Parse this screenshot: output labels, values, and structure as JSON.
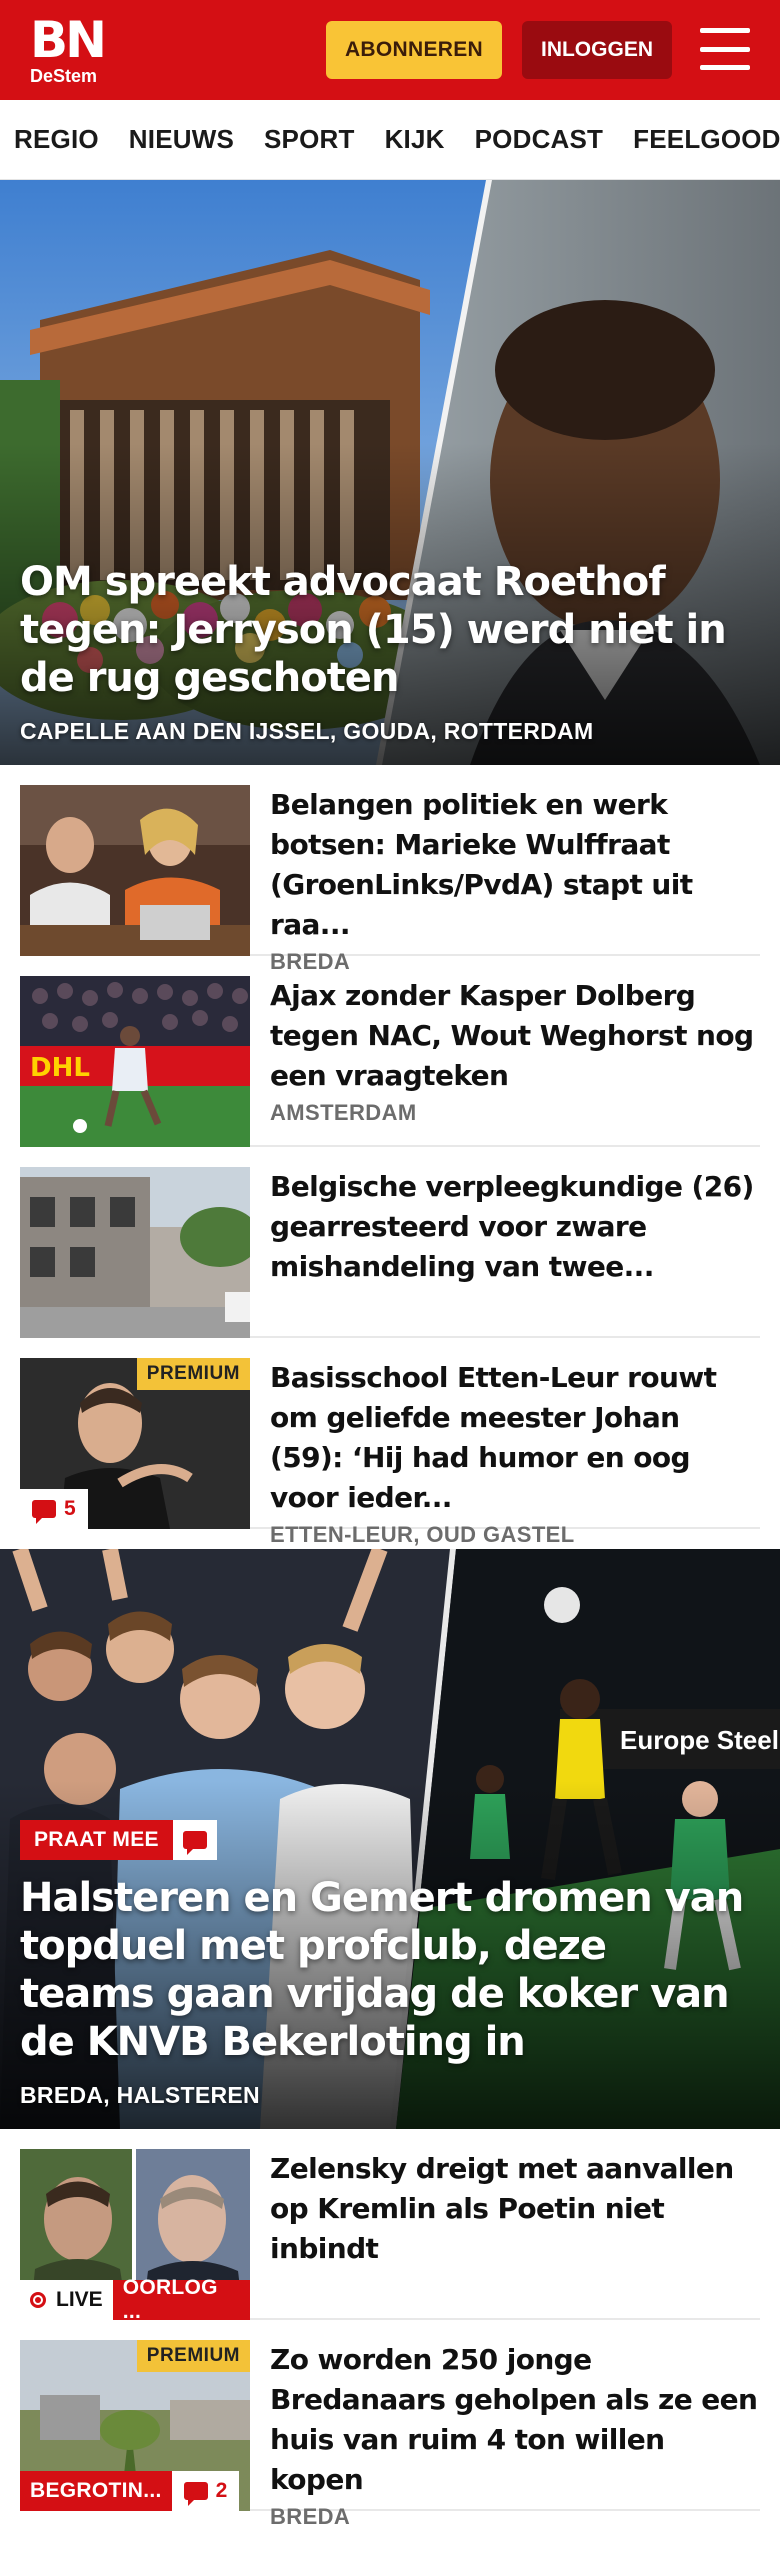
{
  "header": {
    "logo_main": "BN",
    "logo_sub": "DeStem",
    "subscribe_label": "ABONNEREN",
    "login_label": "INLOGGEN"
  },
  "nav": {
    "items": [
      "REGIO",
      "NIEUWS",
      "SPORT",
      "KIJK",
      "PODCAST",
      "FEELGOOD"
    ]
  },
  "hero": {
    "title": "OM spreekt advocaat Roethof tegen: Jerryson (15) werd niet in de rug geschoten",
    "locations": "CAPELLE AAN DEN IJSSEL, GOUDA, ROTTERDAM"
  },
  "articles": [
    {
      "title": "Belangen politiek en werk botsen: Marieke Wulffraat (GroenLinks/PvdA) stapt uit raa...",
      "location": "BREDA"
    },
    {
      "title": "Ajax zonder Kasper Dolberg tegen NAC, Wout Weghorst nog een vraagteken",
      "location": "AMSTERDAM"
    },
    {
      "title": "Belgische verpleegkundige (26) gearresteerd voor zware mishandeling van twee...",
      "location": ""
    },
    {
      "title": "Basisschool Etten-Leur rouwt om geliefde meester Johan (59): ‘Hij had humor en oog voor ieder...",
      "location": "ETTEN-LEUR, OUD GASTEL",
      "premium": "PREMIUM",
      "comments": "5"
    }
  ],
  "feature": {
    "tag": "PRAAT MEE",
    "title": "Halsteren en Gemert dromen van topduel met profclub, deze teams gaan vrijdag de koker van de KNVB Bekerloting in",
    "locations": "BREDA, HALSTEREN"
  },
  "articles2": [
    {
      "title": "Zelensky dreigt met aanvallen op Kremlin als Poetin niet inbindt",
      "live": "LIVE",
      "tag": "OORLOG ..."
    },
    {
      "title": "Zo worden 250 jonge Bredanaars geholpen als ze een huis van ruim 4 ton willen kopen",
      "location": "BREDA",
      "premium": "PREMIUM",
      "tag": "BEGROTIN...",
      "comments": "2"
    }
  ],
  "colors": {
    "brand_red": "#d40f14",
    "subscribe_yellow": "#f9c436",
    "login_dark_red": "#9a0b10",
    "premium_yellow": "#f3c238"
  }
}
